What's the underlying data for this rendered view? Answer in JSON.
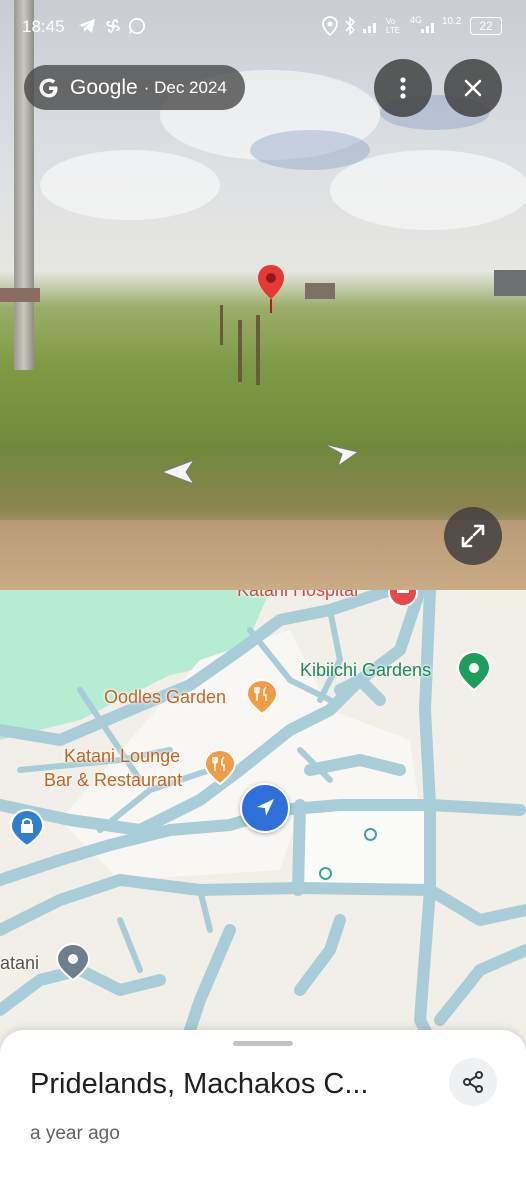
{
  "status_bar": {
    "time": "18:45",
    "network_left": "Vo LTE",
    "network_right": "4G",
    "speed": "10.2",
    "battery": "22"
  },
  "street_view": {
    "provider": "Google",
    "date": "· Dec 2024"
  },
  "map": {
    "labels": {
      "hospital": "Katani Hospital",
      "kibiichi": "Kibiichi Gardens",
      "oodles": "Oodles Garden",
      "lounge_line1": "Katani Lounge",
      "lounge_line2": "Bar & Restaurant",
      "katani": "atani"
    },
    "colors": {
      "road": "#a8cdd8",
      "water": "#b6ecd3",
      "food_pin": "#f29b46",
      "park_pin": "#1e9e5c",
      "hospital_pin": "#e8484a",
      "location_dot": "#2f6fd8"
    }
  },
  "sheet": {
    "title": "Pridelands, Machakos C...",
    "subtitle": "a year ago"
  }
}
